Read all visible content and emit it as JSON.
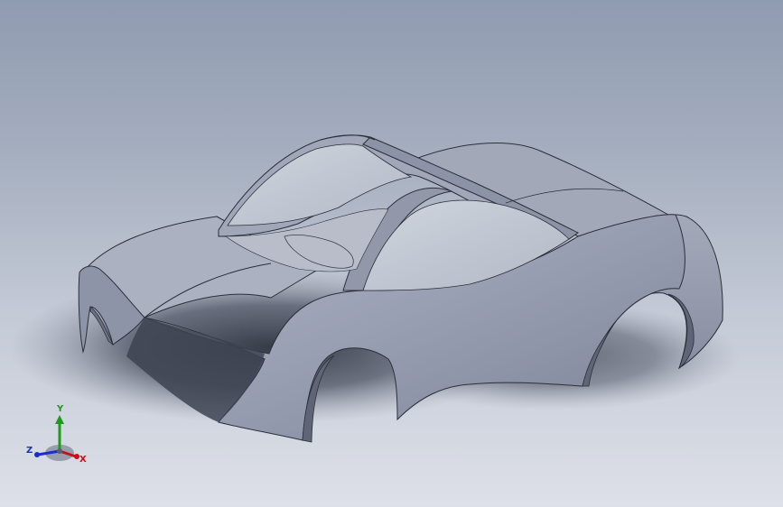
{
  "triad": {
    "x_label": "X",
    "y_label": "Y",
    "z_label": "Z",
    "x_color": "#c8101a",
    "y_color": "#1e9a1e",
    "z_color": "#1a2ec8"
  },
  "model": {
    "body_color": "#9ba1b5",
    "glass_color": "#c2c8d3",
    "shadow_color": "#3c4250"
  }
}
